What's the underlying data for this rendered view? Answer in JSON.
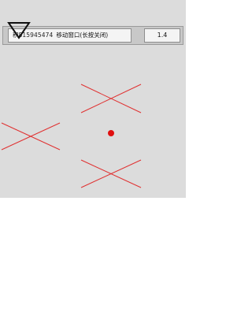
{
  "window": {
    "title_prefix": "积",
    "id_code": "815945474",
    "title_label": "移动窗口(长按关闭)",
    "zoom": "1.4"
  },
  "markers": {
    "cross_color": "#e03030",
    "dot_color": "#e01010"
  },
  "icons": {
    "pointer": "triangle-pointer-icon"
  }
}
